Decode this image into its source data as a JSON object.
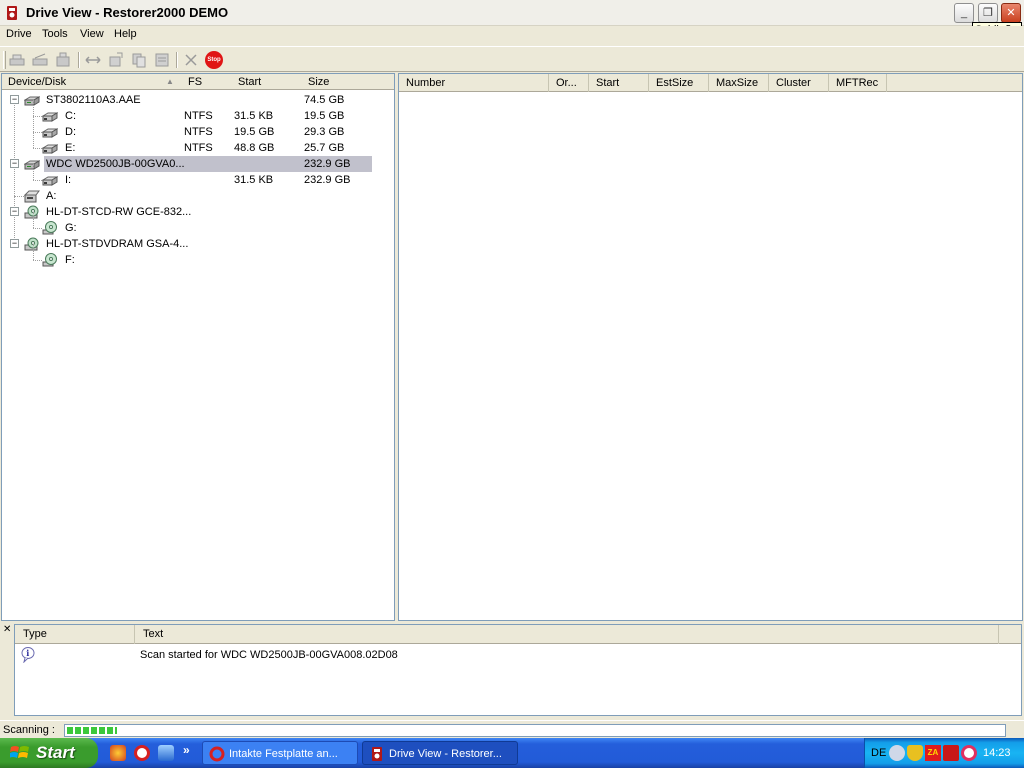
{
  "window": {
    "title": "Drive View - Restorer2000 DEMO",
    "tooltip": "Schließen"
  },
  "menu": [
    "Drive",
    "Tools",
    "View",
    "Help"
  ],
  "toolbar": {
    "stop_label": "Stop"
  },
  "left_pane": {
    "columns": [
      "Device/Disk",
      "FS",
      "Start",
      "Size"
    ],
    "rows": [
      {
        "name": "ST3802110A3.AAE",
        "fs": "",
        "start": "",
        "size": "74.5 GB",
        "icon": "hard-disk-icon",
        "level": 0
      },
      {
        "name": "C:",
        "fs": "NTFS",
        "start": "31.5 KB",
        "size": "19.5 GB",
        "icon": "partition-icon",
        "level": 1
      },
      {
        "name": "D:",
        "fs": "NTFS",
        "start": "19.5 GB",
        "size": "29.3 GB",
        "icon": "partition-icon",
        "level": 1
      },
      {
        "name": "E:",
        "fs": "NTFS",
        "start": "48.8 GB",
        "size": "25.7 GB",
        "icon": "partition-icon",
        "level": 1
      },
      {
        "name": "WDC WD2500JB-00GVA0...",
        "fs": "",
        "start": "",
        "size": "232.9 GB",
        "icon": "hard-disk-icon",
        "level": 0,
        "selected": true
      },
      {
        "name": "I:",
        "fs": "",
        "start": "31.5 KB",
        "size": "232.9 GB",
        "icon": "partition-icon",
        "level": 1
      },
      {
        "name": "A:",
        "fs": "",
        "start": "",
        "size": "",
        "icon": "floppy-drive-icon",
        "level": 0
      },
      {
        "name": "HL-DT-STCD-RW GCE-832...",
        "fs": "",
        "start": "",
        "size": "",
        "icon": "cd-drive-icon",
        "level": 0
      },
      {
        "name": "G:",
        "fs": "",
        "start": "",
        "size": "",
        "icon": "cd-icon",
        "level": 1
      },
      {
        "name": "HL-DT-STDVDRAM GSA-4...",
        "fs": "",
        "start": "",
        "size": "",
        "icon": "cd-drive-icon",
        "level": 0
      },
      {
        "name": "F:",
        "fs": "",
        "start": "",
        "size": "",
        "icon": "cd-icon",
        "level": 1
      }
    ]
  },
  "right_pane": {
    "columns": [
      "Number",
      "Or...",
      "Start",
      "EstSize",
      "MaxSize",
      "Cluster",
      "MFTRec"
    ]
  },
  "log": {
    "columns": [
      "Type",
      "Text"
    ],
    "rows": [
      {
        "type_icon": "info-icon",
        "text": "Scan started for WDC WD2500JB-00GVA008.02D08"
      }
    ]
  },
  "status": {
    "label": "Scanning :",
    "progress_fraction": 0.053
  },
  "taskbar": {
    "start_label": "Start",
    "tasks": [
      {
        "label": "Intakte Festplatte an...",
        "active": false
      },
      {
        "label": "Drive View - Restorer...",
        "active": true
      }
    ],
    "tray_lang": "DE",
    "clock": "14:23"
  },
  "colors": {
    "selection": "#c1c1cc",
    "progress": "#3bc83b",
    "taskbar": "#245edb",
    "start": "#3a9c2d",
    "tray": "#18b4f3"
  }
}
